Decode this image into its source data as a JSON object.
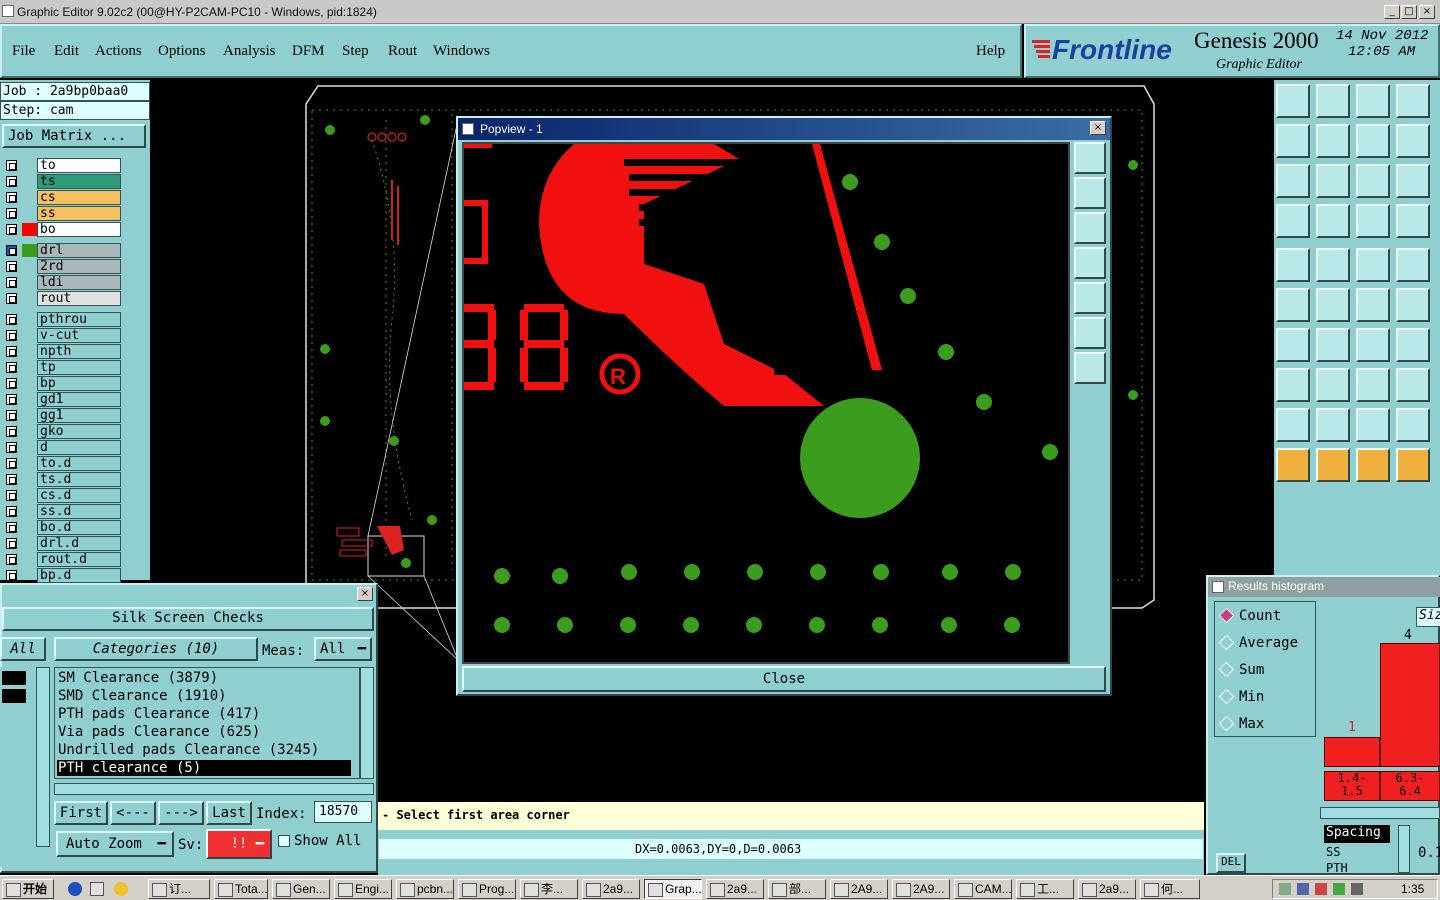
{
  "window": {
    "title": "Graphic Editor 9.02c2 (00@HY-P2CAM-PC10 - Windows, pid:1824)"
  },
  "menu": [
    "File",
    "Edit",
    "Actions",
    "Options",
    "Analysis",
    "DFM",
    "Step",
    "Rout",
    "Windows"
  ],
  "help": "Help",
  "brand": {
    "logo": "Frontline",
    "product": "Genesis 2000",
    "subtitle": "Graphic Editor",
    "date": "14 Nov 2012",
    "time": "12:05 AM"
  },
  "job": {
    "job_line": "Job : 2a9bp0baa0",
    "step_line": "Step: cam",
    "matrix_button": "Job Matrix ..."
  },
  "layers": [
    {
      "name": "to",
      "color": "#ffffff"
    },
    {
      "name": "ts",
      "color": "#2e9a7a"
    },
    {
      "name": "cs",
      "color": "#f5c060"
    },
    {
      "name": "ss",
      "color": "#f5c060"
    },
    {
      "name": "bo",
      "color": "#ffffff"
    },
    {
      "name": "drl",
      "color": "#a8b8b8"
    },
    {
      "name": "2rd",
      "color": "#a8b8b8"
    },
    {
      "name": "ldi",
      "color": "#a8b8b8"
    },
    {
      "name": "rout",
      "color": "#e0e0e0"
    },
    {
      "name": "pthrou",
      "color": "#8fcfcf"
    },
    {
      "name": "v-cut",
      "color": "#8fcfcf"
    },
    {
      "name": "npth",
      "color": "#8fcfcf"
    },
    {
      "name": "tp",
      "color": "#8fcfcf"
    },
    {
      "name": "bp",
      "color": "#8fcfcf"
    },
    {
      "name": "gd1",
      "color": "#8fcfcf"
    },
    {
      "name": "gg1",
      "color": "#8fcfcf"
    },
    {
      "name": "gko",
      "color": "#8fcfcf"
    },
    {
      "name": "d",
      "color": "#8fcfcf"
    },
    {
      "name": "to.d",
      "color": "#8fcfcf"
    },
    {
      "name": "ts.d",
      "color": "#8fcfcf"
    },
    {
      "name": "cs.d",
      "color": "#8fcfcf"
    },
    {
      "name": "ss.d",
      "color": "#8fcfcf"
    },
    {
      "name": "bo.d",
      "color": "#8fcfcf"
    },
    {
      "name": "drl.d",
      "color": "#8fcfcf"
    },
    {
      "name": "rout.d",
      "color": "#8fcfcf"
    },
    {
      "name": "bp.d",
      "color": "#8fcfcf"
    }
  ],
  "popview": {
    "title": "Popview - 1",
    "close": "Close",
    "marking_text": "38"
  },
  "silk": {
    "title": "Silk Screen Checks",
    "all": "All",
    "categories": "Categories (10)",
    "meas_label": "Meas:",
    "meas_value": "All",
    "items": [
      "SM Clearance (3879)",
      "SMD Clearance (1910)",
      "PTH pads Clearance (417)",
      "Via pads Clearance (625)",
      "Undrilled pads Clearance (3245)",
      "PTH clearance (5)"
    ],
    "nav": [
      "First",
      "<---",
      "--->",
      "Last"
    ],
    "index_label": "Index:",
    "index_value": "18570",
    "auto_zoom": "Auto Zoom",
    "sv_label": "Sv:",
    "sv_value": "!!",
    "show_all": "Show All"
  },
  "prompt": "- Select first area corner",
  "status": "DX=0.0063,DY=0,D=0.0063",
  "histogram": {
    "title": "Results histogram",
    "options": [
      "Count",
      "Average",
      "Sum",
      "Min",
      "Max"
    ],
    "selected": "Count",
    "header": "Siz",
    "bars": [
      {
        "label": "1",
        "range": [
          "1.4-",
          "1.5"
        ],
        "value": 1
      },
      {
        "label": "4",
        "range": [
          "6.3-",
          "6.4"
        ],
        "value": 4
      }
    ],
    "spacing": "Spacing",
    "ss": "SS",
    "pth": "PTH",
    "del": "DEL",
    "side_value": "0.1"
  },
  "taskbar": {
    "start": "开始",
    "tasks": [
      "订...",
      "Tota...",
      "Gen...",
      "Engi...",
      "pcbn...",
      "Prog...",
      "李...",
      "2a9...",
      "Grap...",
      "2a9...",
      "部...",
      "2A9...",
      "2A9...",
      "CAM...",
      "工...",
      "2a9...",
      "何..."
    ],
    "clock": "1:35"
  }
}
